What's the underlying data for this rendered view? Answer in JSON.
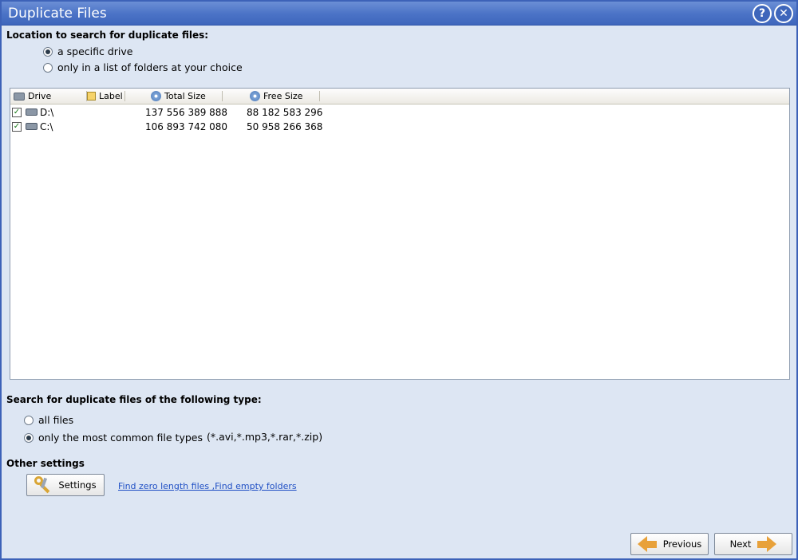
{
  "window": {
    "title": "Duplicate Files",
    "help_glyph": "?",
    "close_glyph": "✕"
  },
  "location": {
    "heading": "Location to search for duplicate files:",
    "options": [
      {
        "label": "a specific drive",
        "selected": true
      },
      {
        "label": "only in a list of folders at your choice",
        "selected": false
      }
    ]
  },
  "drives_table": {
    "columns": [
      {
        "label": "Drive",
        "icon": "drive-icon"
      },
      {
        "label": "Label",
        "icon": "label-icon"
      },
      {
        "label": "Total Size",
        "icon": "disk-icon"
      },
      {
        "label": "Free Size",
        "icon": "disk-icon"
      }
    ],
    "rows": [
      {
        "checked": true,
        "drive": "D:\\",
        "label": "",
        "total_size": "137 556 389 888",
        "free_size": "88 182 583 296"
      },
      {
        "checked": true,
        "drive": "C:\\",
        "label": "",
        "total_size": "106 893 742 080",
        "free_size": "50 958 266 368"
      }
    ]
  },
  "file_type": {
    "heading": "Search for duplicate files of the following type:",
    "options": [
      {
        "label": "all files",
        "selected": false
      },
      {
        "label": "only the most common file types",
        "selected": true
      }
    ],
    "common_types_hint": "(*.avi,*.mp3,*.rar,*.zip)"
  },
  "other_settings": {
    "heading": "Other settings",
    "settings_button": "Settings",
    "link_text": "Find zero length files ,Find empty folders"
  },
  "navigation": {
    "previous": "Previous",
    "next": "Next"
  },
  "colors": {
    "titlebar": "#4a72c6",
    "background": "#dde6f3",
    "link": "#1f4fc4",
    "arrow": "#e8a13a"
  }
}
